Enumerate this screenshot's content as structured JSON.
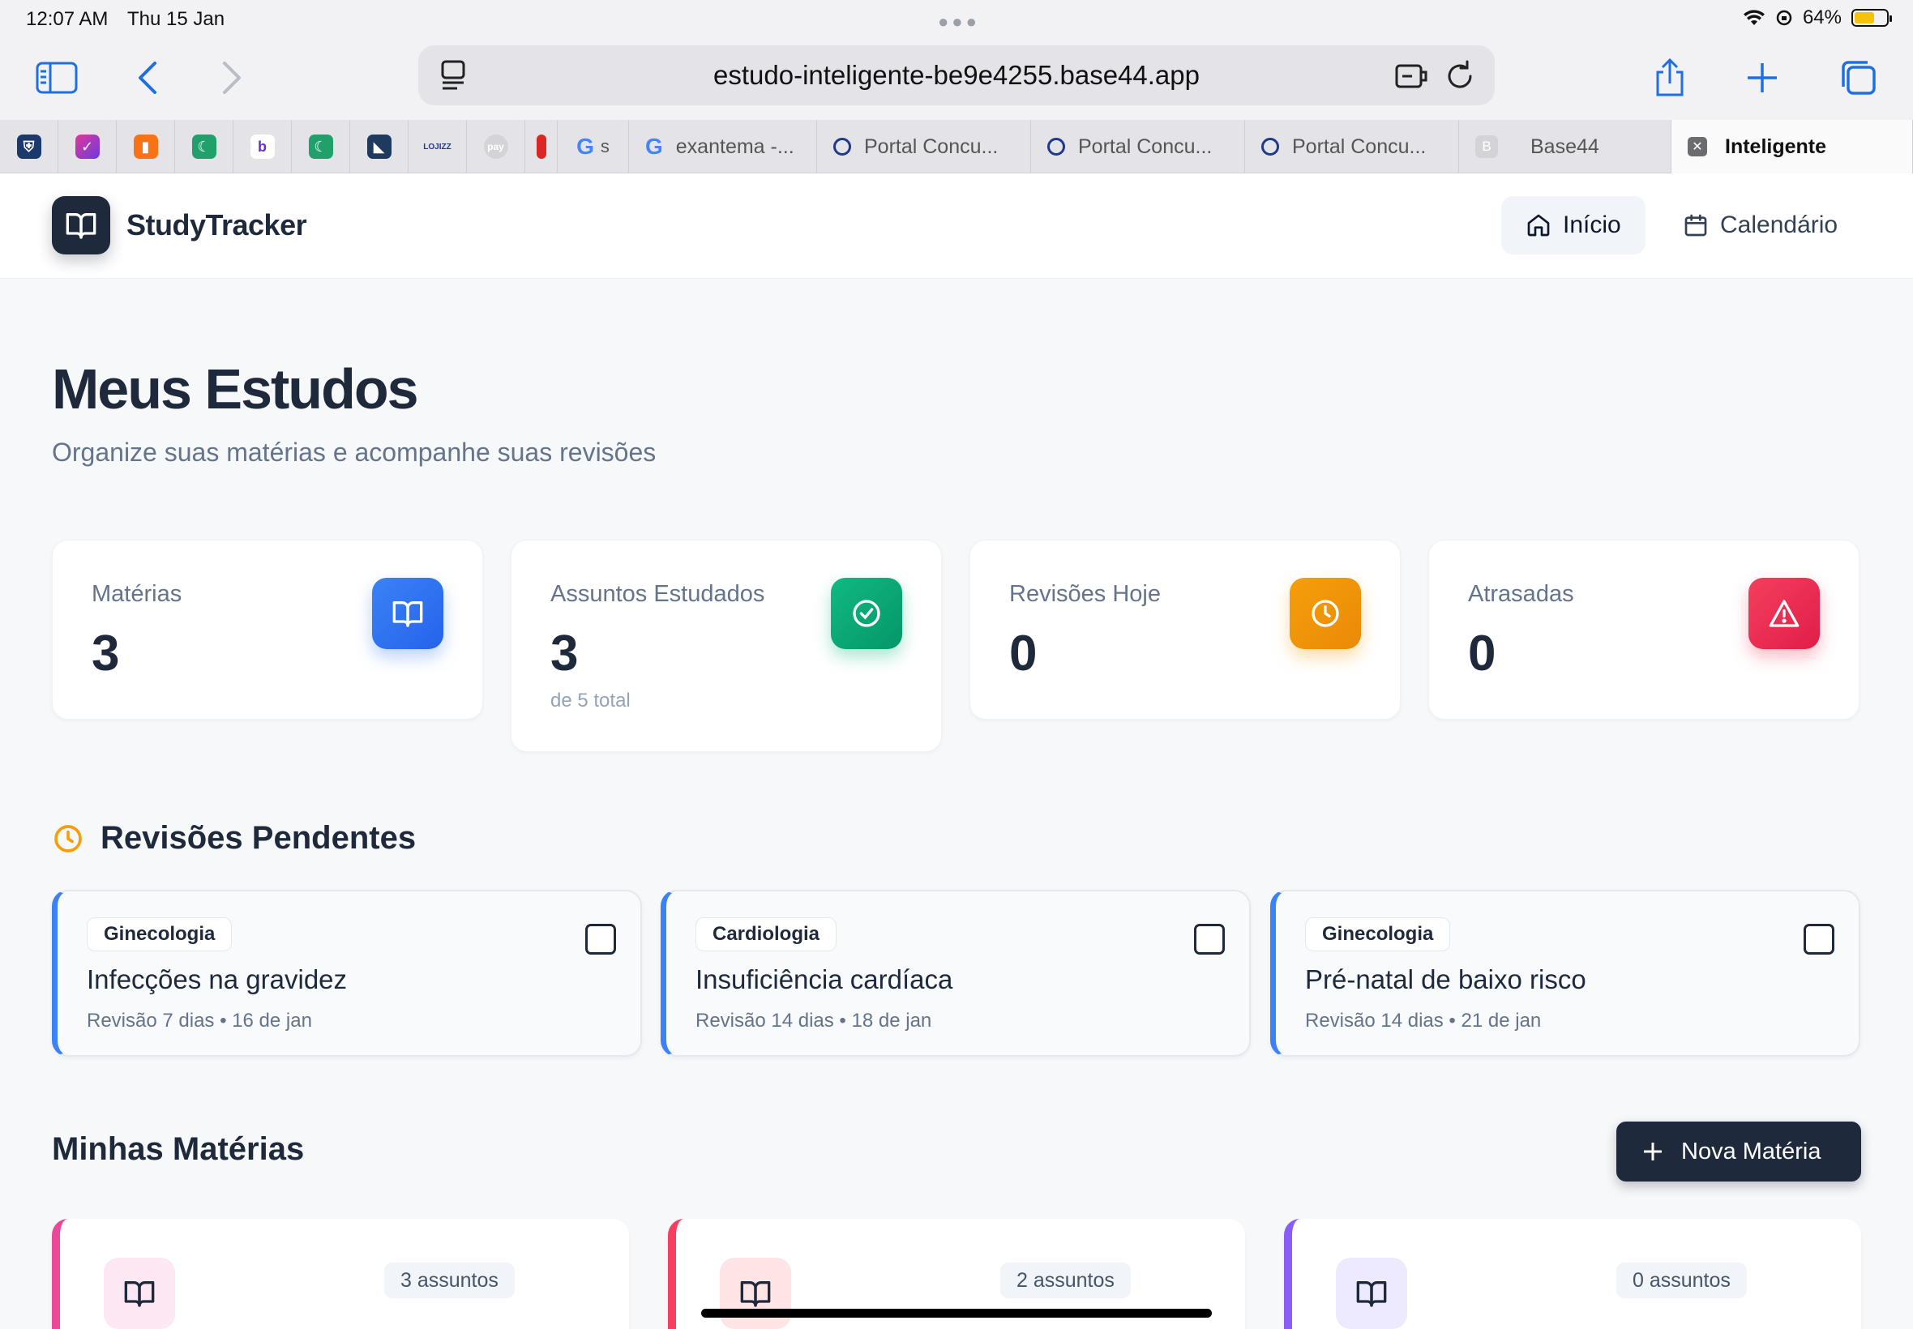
{
  "statusbar": {
    "time": "12:07 AM",
    "date": "Thu 15 Jan",
    "battery": "64%"
  },
  "browser": {
    "url": "estudo-inteligente-be9e4255.base44.app",
    "tabs": [
      {
        "label": "exantema -...",
        "icon": "google-icon"
      },
      {
        "label": "Portal Concu...",
        "icon": "portal-icon"
      },
      {
        "label": "Portal Concu...",
        "icon": "portal-icon"
      },
      {
        "label": "Portal Concu...",
        "icon": "portal-icon"
      },
      {
        "label": "Base44",
        "icon": "base44-icon"
      },
      {
        "label": "Inteligente",
        "icon": "close-icon"
      }
    ],
    "mini_tab_letters": {
      "b": "b",
      "s": "s",
      "B": "B"
    },
    "pinned_text": {
      "lojizz": "LOJIZZ",
      "pay": "pay"
    }
  },
  "app": {
    "name": "StudyTracker",
    "nav": {
      "home": "Início",
      "calendar": "Calendário"
    },
    "title": "Meus Estudos",
    "subtitle": "Organize suas matérias e acompanhe suas revisões",
    "stats": [
      {
        "label": "Matérias",
        "value": "3",
        "hint": "",
        "color": "#3b82f6"
      },
      {
        "label": "Assuntos Estudados",
        "value": "3",
        "hint": "de 5 total",
        "color": "#10b981"
      },
      {
        "label": "Revisões Hoje",
        "value": "0",
        "hint": "",
        "color": "#f59e0b"
      },
      {
        "label": "Atrasadas",
        "value": "0",
        "hint": "",
        "color": "#f43f5e"
      }
    ],
    "pending": {
      "heading": "Revisões Pendentes",
      "items": [
        {
          "subject": "Ginecologia",
          "topic": "Infecções na gravidez",
          "interval": "Revisão 7 dias",
          "date": "16 de jan"
        },
        {
          "subject": "Cardiologia",
          "topic": "Insuficiência cardíaca",
          "interval": "Revisão 14 dias",
          "date": "18 de jan"
        },
        {
          "subject": "Ginecologia",
          "topic": "Pré-natal de baixo risco",
          "interval": "Revisão 14 dias",
          "date": "21 de jan"
        }
      ]
    },
    "subjects": {
      "heading": "Minhas Matérias",
      "new_button": "Nova Matéria",
      "items": [
        {
          "count": "3 assuntos",
          "color": "#ec4899",
          "tint": "#fce7f3"
        },
        {
          "count": "2 assuntos",
          "color": "#f43f5e",
          "tint": "#ffe4e6"
        },
        {
          "count": "0 assuntos",
          "color": "#8b5cf6",
          "tint": "#ede9fe"
        }
      ]
    }
  }
}
